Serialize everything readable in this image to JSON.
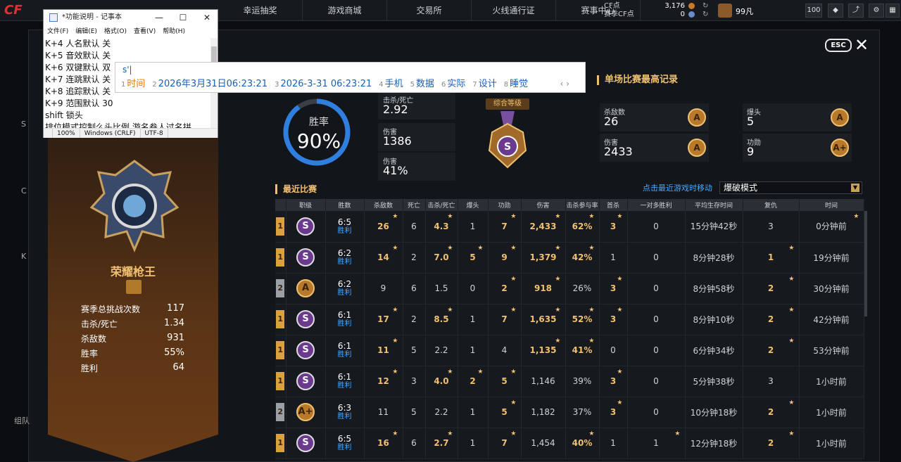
{
  "nav": {
    "items": [
      "幸运抽奖",
      "游戏商城",
      "交易所",
      "火线通行证",
      "赛事中心"
    ]
  },
  "currency": {
    "cf_label": "CF点",
    "season_cf_label": "赛季CF点",
    "cf_value": "3,176",
    "season_cf_value": "0"
  },
  "user": {
    "name": "99凡",
    "level": "100"
  },
  "overlay": {
    "esc": "ESC"
  },
  "profile": {
    "rank_title": "荣耀枪王",
    "stats": [
      {
        "label": "赛季总挑战次数",
        "value": "117"
      },
      {
        "label": "击杀/死亡",
        "value": "1.34"
      },
      {
        "label": "杀敌数",
        "value": "931"
      },
      {
        "label": "胜率",
        "value": "55%"
      },
      {
        "label": "胜利",
        "value": "64"
      }
    ]
  },
  "summary": {
    "winrate_label": "胜率",
    "winrate_value": "90%",
    "winrate_fraction": 0.9,
    "kd_label": "击杀/死亡",
    "kd": "2.92",
    "damage_label": "伤害",
    "damage": "1386",
    "dmg_pct_label": "伤害",
    "dmg_pct": "41%",
    "medal_label": "综合等级",
    "medal_grade": "S"
  },
  "best": {
    "title": "单场比赛最高记录",
    "items": [
      {
        "label": "杀敌数",
        "value": "26",
        "grade": "A"
      },
      {
        "label": "爆头",
        "value": "5",
        "grade": "A"
      },
      {
        "label": "伤害",
        "value": "2433",
        "grade": "A"
      },
      {
        "label": "功勋",
        "value": "9",
        "grade": "A+"
      }
    ]
  },
  "recent": {
    "title": "最近比赛",
    "link": "点击最近游戏时移动",
    "mode": "爆破模式"
  },
  "table": {
    "headers": [
      "职级",
      "胜数",
      "杀敌数",
      "死亡",
      "击杀/死亡",
      "爆头",
      "功勋",
      "伤害",
      "击杀参与率",
      "首杀",
      "一对多胜利",
      "平均生存时间",
      "复仇",
      "时间"
    ],
    "rows": [
      {
        "rank": "1",
        "grade": "S",
        "score": "6:5",
        "result": "胜利",
        "kills": "26",
        "deaths": "6",
        "kd": "4.3",
        "hs": "1",
        "merit": "7",
        "dmg": "2,433",
        "part": "62%",
        "first": "3",
        "clutch": "0",
        "surv": "15分钟42秒",
        "rev": "3",
        "time": "0分钟前",
        "stars": [
          1,
          0,
          1,
          0,
          1,
          1,
          1,
          1,
          0,
          0,
          0,
          1
        ]
      },
      {
        "rank": "1",
        "grade": "S",
        "score": "6:2",
        "result": "胜利",
        "kills": "14",
        "deaths": "2",
        "kd": "7.0",
        "hs": "5",
        "merit": "9",
        "dmg": "1,379",
        "part": "42%",
        "first": "1",
        "clutch": "0",
        "surv": "8分钟28秒",
        "rev": "1",
        "time": "19分钟前",
        "stars": [
          1,
          0,
          1,
          1,
          1,
          1,
          1,
          0,
          0,
          0,
          1,
          0
        ]
      },
      {
        "rank": "2",
        "grade": "A",
        "score": "6:2",
        "result": "胜利",
        "kills": "9",
        "deaths": "6",
        "kd": "1.5",
        "hs": "0",
        "merit": "2",
        "dmg": "918",
        "part": "26%",
        "first": "3",
        "clutch": "0",
        "surv": "8分钟58秒",
        "rev": "2",
        "time": "30分钟前",
        "stars": [
          0,
          0,
          0,
          0,
          1,
          1,
          0,
          1,
          0,
          0,
          1,
          0
        ]
      },
      {
        "rank": "1",
        "grade": "S",
        "score": "6:1",
        "result": "胜利",
        "kills": "17",
        "deaths": "2",
        "kd": "8.5",
        "hs": "1",
        "merit": "7",
        "dmg": "1,635",
        "part": "52%",
        "first": "3",
        "clutch": "0",
        "surv": "8分钟10秒",
        "rev": "2",
        "time": "42分钟前",
        "stars": [
          1,
          0,
          1,
          0,
          1,
          1,
          1,
          1,
          0,
          0,
          1,
          0
        ]
      },
      {
        "rank": "1",
        "grade": "S",
        "score": "6:1",
        "result": "胜利",
        "kills": "11",
        "deaths": "5",
        "kd": "2.2",
        "hs": "1",
        "merit": "4",
        "dmg": "1,135",
        "part": "41%",
        "first": "0",
        "clutch": "0",
        "surv": "6分钟34秒",
        "rev": "2",
        "time": "53分钟前",
        "stars": [
          1,
          0,
          0,
          0,
          0,
          1,
          1,
          0,
          0,
          0,
          1,
          0
        ]
      },
      {
        "rank": "1",
        "grade": "S",
        "score": "6:1",
        "result": "胜利",
        "kills": "12",
        "deaths": "3",
        "kd": "4.0",
        "hs": "2",
        "merit": "5",
        "dmg": "1,146",
        "part": "39%",
        "first": "3",
        "clutch": "0",
        "surv": "5分钟38秒",
        "rev": "3",
        "time": "1小时前",
        "stars": [
          1,
          0,
          1,
          1,
          1,
          0,
          0,
          1,
          0,
          0,
          0,
          0
        ]
      },
      {
        "rank": "2",
        "grade": "A+",
        "score": "6:3",
        "result": "胜利",
        "kills": "11",
        "deaths": "5",
        "kd": "2.2",
        "hs": "1",
        "merit": "5",
        "dmg": "1,182",
        "part": "37%",
        "first": "3",
        "clutch": "0",
        "surv": "10分钟18秒",
        "rev": "2",
        "time": "1小时前",
        "stars": [
          0,
          0,
          0,
          0,
          1,
          0,
          0,
          1,
          0,
          0,
          1,
          0
        ]
      },
      {
        "rank": "1",
        "grade": "S",
        "score": "6:5",
        "result": "胜利",
        "kills": "16",
        "deaths": "6",
        "kd": "2.7",
        "hs": "1",
        "merit": "7",
        "dmg": "1,454",
        "part": "40%",
        "first": "1",
        "clutch": "1",
        "surv": "12分钟18秒",
        "rev": "2",
        "time": "1小时前",
        "stars": [
          1,
          0,
          1,
          0,
          1,
          0,
          1,
          0,
          1,
          0,
          1,
          0
        ]
      }
    ]
  },
  "notepad": {
    "title": "*功能说明 - 记事本",
    "menu": [
      "文件(F)",
      "编辑(E)",
      "格式(O)",
      "查看(V)",
      "帮助(H)"
    ],
    "lines": [
      "K+4 人名默认 关",
      "K+5 音效默认 关",
      "K+6 双键默认 双",
      "K+7 连跳默认 关",
      "K+8 追踪默认 关",
      "K+9 范围默认 30",
      "shift 锁头",
      "排位模式控制么头比例 游名叁人过名拼"
    ],
    "status": [
      "100%",
      "Windows (CRLF)",
      "UTF-8"
    ]
  },
  "ime": {
    "input": "s'|",
    "candidates": [
      {
        "n": "1",
        "t": "时间"
      },
      {
        "n": "2",
        "t": "2026年3月31日06:23:21"
      },
      {
        "n": "3",
        "t": "2026-3-31 06:23:21"
      },
      {
        "n": "4",
        "t": "手机"
      },
      {
        "n": "5",
        "t": "数据"
      },
      {
        "n": "6",
        "t": "实际"
      },
      {
        "n": "7",
        "t": "设计"
      },
      {
        "n": "8",
        "t": "睡觉"
      }
    ],
    "nav": "‹ ›"
  },
  "sidebar_fragments": [
    "S",
    "C",
    "K",
    "组队"
  ]
}
